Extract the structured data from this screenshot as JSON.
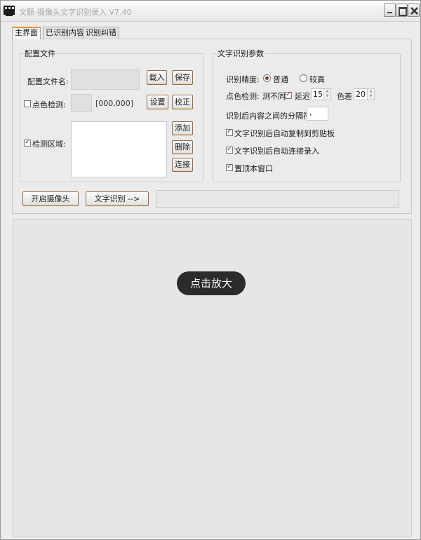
{
  "window": {
    "title": "文颢-摄像头文字识别录入 V7.40",
    "icon": "film-reel-icon"
  },
  "tabs": [
    "主界面",
    "已识别内容",
    "识别纠错"
  ],
  "config_group": {
    "title": "配置文件",
    "config_name_label": "配置文件名:",
    "load_label": "载入",
    "save_label": "保存",
    "color_check_label": "点色检测:",
    "color_check_checked": false,
    "color_coords": "[000,000]",
    "setup_label": "设置",
    "calibrate_label": "校正",
    "detect_area_label": "检测区域:",
    "detect_area_checked": true,
    "add_label": "添加",
    "delete_label": "删除",
    "connect_label": "连接"
  },
  "ocr_group": {
    "title": "文字识别参数",
    "precision_label": "识别精度:",
    "precision_options": [
      "普通",
      "较高"
    ],
    "precision_selected": "普通",
    "dot_check_label": "点色检测:",
    "test_diff_label": "测不同",
    "test_diff_checked": true,
    "delay_label": "延迟",
    "delay_value": "15",
    "color_diff_label": "色差",
    "color_diff_value": "20",
    "separator_label": "识别后内容之间的分隔符:",
    "separator_value": ",",
    "options": [
      {
        "label": "文字识别后自动复制到剪贴板",
        "checked": true
      },
      {
        "label": "文字识别后自动连接录入",
        "checked": true
      },
      {
        "label": "置顶本窗口",
        "checked": true
      }
    ]
  },
  "actions": {
    "open_camera_label": "开启摄像头",
    "ocr_label": "文字识别 -->",
    "status_text": ""
  },
  "preview": {
    "zoom_hint": "点击放大"
  },
  "colors": {
    "accent_tab": "#e59a3c",
    "check_mark": "#8a2a5a",
    "button_border": "#8b6e4e"
  }
}
